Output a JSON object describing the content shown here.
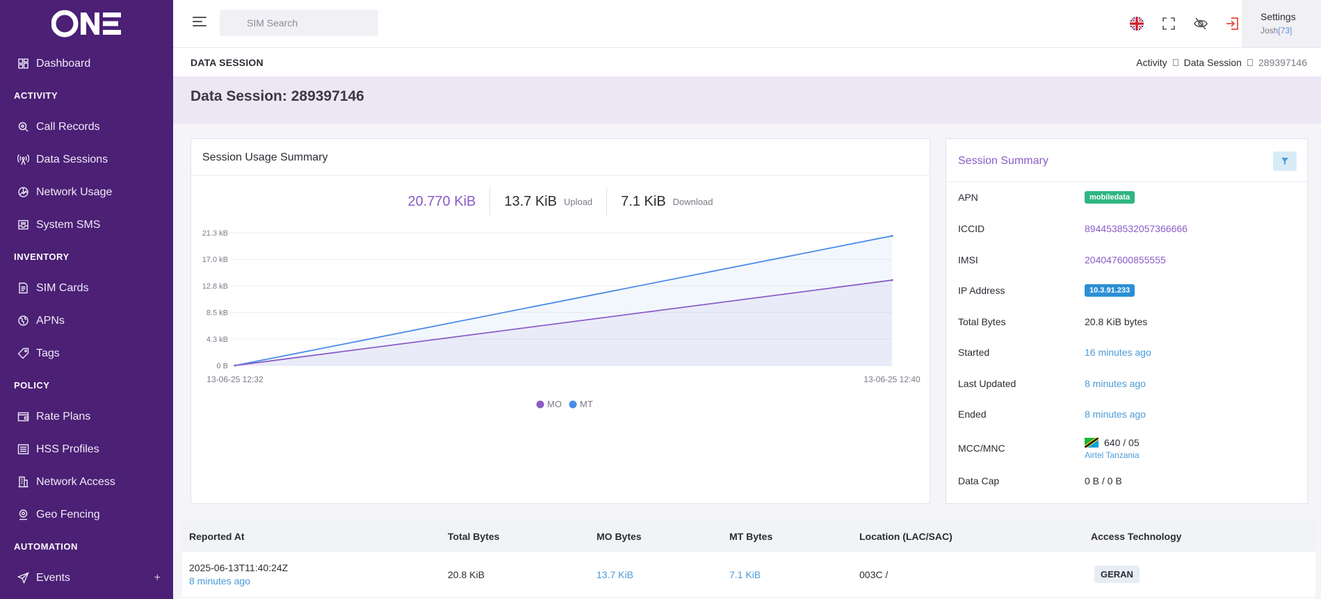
{
  "app": {
    "logo_text": "ONE"
  },
  "sidebar": {
    "items": [
      {
        "type": "item",
        "label": "Dashboard",
        "icon": "dashboard-icon"
      },
      {
        "type": "section",
        "label": "ACTIVITY"
      },
      {
        "type": "item",
        "label": "Call Records",
        "icon": "search-icon"
      },
      {
        "type": "item",
        "label": "Data Sessions",
        "icon": "broadcast-icon"
      },
      {
        "type": "item",
        "label": "Network Usage",
        "icon": "chart-icon"
      },
      {
        "type": "item",
        "label": "System SMS",
        "icon": "inbox-icon"
      },
      {
        "type": "section",
        "label": "INVENTORY"
      },
      {
        "type": "item",
        "label": "SIM Cards",
        "icon": "document-icon"
      },
      {
        "type": "item",
        "label": "APNs",
        "icon": "globe-icon"
      },
      {
        "type": "item",
        "label": "Tags",
        "icon": "tag-icon"
      },
      {
        "type": "section",
        "label": "POLICY"
      },
      {
        "type": "item",
        "label": "Rate Plans",
        "icon": "wallet-icon"
      },
      {
        "type": "item",
        "label": "HSS Profiles",
        "icon": "list-icon"
      },
      {
        "type": "item",
        "label": "Network Access",
        "icon": "building-icon"
      },
      {
        "type": "item",
        "label": "Geo Fencing",
        "icon": "pin-icon"
      },
      {
        "type": "section",
        "label": "AUTOMATION"
      },
      {
        "type": "item",
        "label": "Events",
        "icon": "send-icon",
        "action": "+"
      }
    ]
  },
  "topbar": {
    "search_placeholder": "SIM Search",
    "settings_label": "Settings",
    "user_name": "Josh",
    "user_id": "[73]"
  },
  "page": {
    "header_title": "DATA SESSION",
    "breadcrumb": [
      "Activity",
      "Data Session",
      "289397146"
    ],
    "title": "Data Session: 289397146"
  },
  "usage": {
    "title": "Session Usage Summary",
    "total": "20.770 KiB",
    "upload_value": "13.7 KiB",
    "upload_label": "Upload",
    "download_value": "7.1 KiB",
    "download_label": "Download"
  },
  "chart_data": {
    "type": "area",
    "x": [
      "13-06-25 12:32",
      "13-06-25 12:40"
    ],
    "x_tick_labels": [
      "13-06-25 12:32",
      "13-06-25 12:40"
    ],
    "y_tick_labels": [
      "0 B",
      "4.3 kB",
      "8.5 kB",
      "12.8 kB",
      "17.0 kB",
      "21.3 kB"
    ],
    "ylim": [
      0,
      21.3
    ],
    "series": [
      {
        "name": "MO",
        "color": "#8a5cc7",
        "values": [
          0,
          13.7
        ]
      },
      {
        "name": "MT",
        "color": "#4a8ae8",
        "values": [
          0,
          20.8
        ]
      }
    ],
    "legend": "bottom-center",
    "grid": true
  },
  "summary": {
    "title": "Session Summary",
    "rows": {
      "apn_key": "APN",
      "apn_val": "mobiledata",
      "iccid_key": "ICCID",
      "iccid_val": "8944538532057366666",
      "imsi_key": "IMSI",
      "imsi_val": "204047600855555",
      "ip_key": "IP Address",
      "ip_val": "10.3.91.233",
      "total_key": "Total Bytes",
      "total_val": "20.8 KiB bytes",
      "started_key": "Started",
      "started_val": "16 minutes ago",
      "updated_key": "Last Updated",
      "updated_val": "8 minutes ago",
      "ended_key": "Ended",
      "ended_val": "8 minutes ago",
      "mcc_key": "MCC/MNC",
      "mcc_val": "640 / 05",
      "mcc_operator": "Airtel Tanzania",
      "cap_key": "Data Cap",
      "cap_val": "0 B / 0 B"
    }
  },
  "table": {
    "headers": [
      "Reported At",
      "Total Bytes",
      "MO Bytes",
      "MT Bytes",
      "Location (LAC/SAC)",
      "Access Technology"
    ],
    "rows": [
      {
        "reported_at": "2025-06-13T11:40:24Z",
        "reported_ago": "8 minutes ago",
        "total": "20.8 KiB",
        "mo": "13.7 KiB",
        "mt": "7.1 KiB",
        "location": "003C /",
        "tech": "GERAN"
      }
    ]
  }
}
